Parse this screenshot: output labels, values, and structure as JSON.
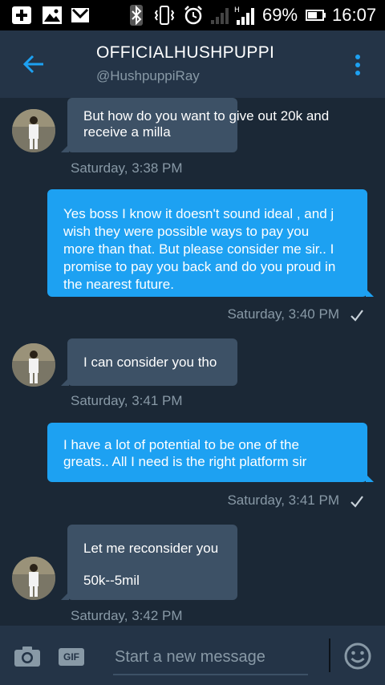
{
  "status_bar": {
    "battery_percent": "69%",
    "time": "16:07"
  },
  "header": {
    "title": "OFFICIALHUSHPUPPI",
    "handle": "@HushpuppiRay"
  },
  "messages": [
    {
      "direction": "in",
      "lines": [
        "But how do you want to give out 20k and",
        "receive a milla"
      ],
      "time": "Saturday, 3:38 PM"
    },
    {
      "direction": "out",
      "lines": [
        "Yes boss I know it doesn't sound ideal , and j",
        "wish they were possible ways to pay you",
        "more than that. But please consider me sir.. I",
        "promise to pay you back and do you proud in",
        "the nearest future."
      ],
      "time": "Saturday, 3:40 PM"
    },
    {
      "direction": "in",
      "lines": [
        "I can consider you tho"
      ],
      "time": "Saturday, 3:41 PM"
    },
    {
      "direction": "out",
      "lines": [
        "I have a lot of potential to be one of the",
        "greats.. All I need is the right platform sir"
      ],
      "time": "Saturday, 3:41 PM"
    },
    {
      "direction": "in",
      "lines": [
        "Let me reconsider you",
        "50k--5mil"
      ],
      "time": "Saturday, 3:42 PM"
    }
  ],
  "composer": {
    "gif_label": "GIF",
    "placeholder": "Start a new message"
  },
  "colors": {
    "background": "#1b2836",
    "header": "#243447",
    "incoming_bubble": "#3d5166",
    "outgoing_bubble": "#1da1f2",
    "secondary_text": "#8899a6"
  }
}
